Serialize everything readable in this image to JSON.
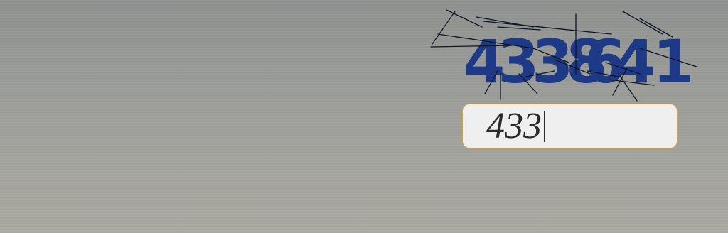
{
  "captcha": {
    "digits": [
      "4",
      "3",
      "3",
      "8",
      "6",
      "4",
      "1"
    ],
    "digit_color": "#1e3a86",
    "noise_color": "#0e1624"
  },
  "answer_field": {
    "value": "433"
  }
}
